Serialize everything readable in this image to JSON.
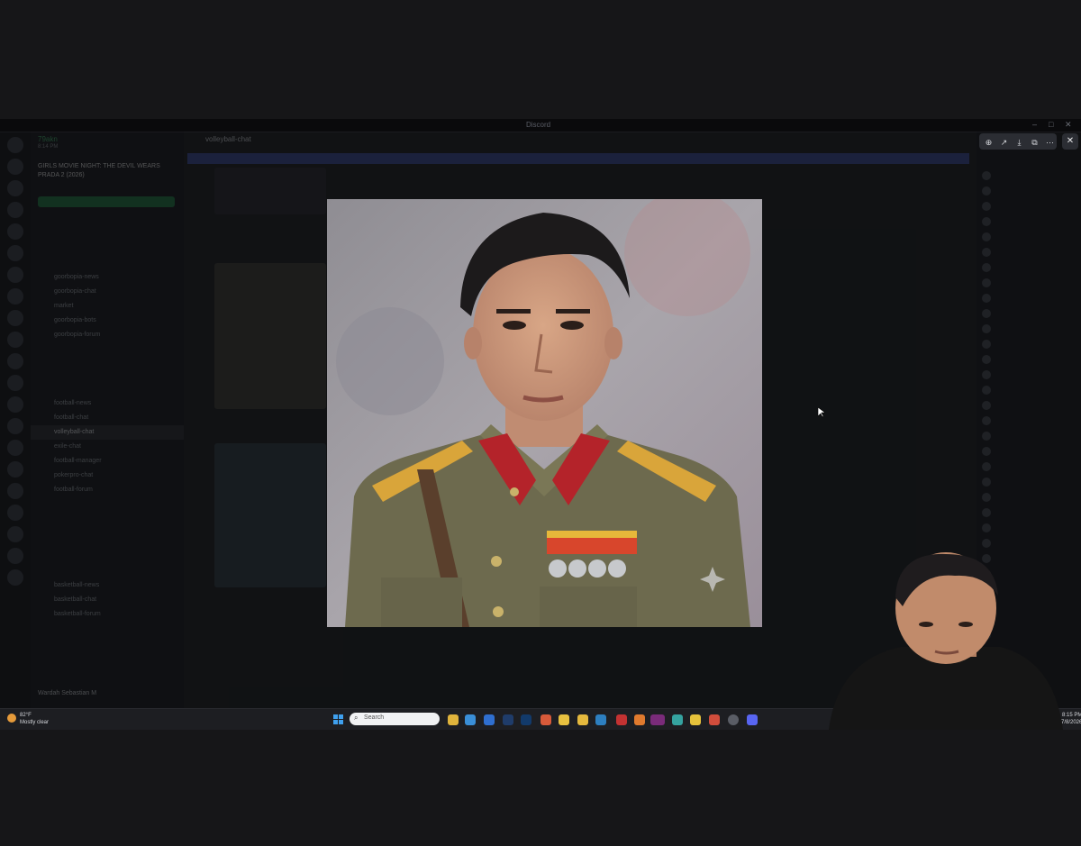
{
  "window": {
    "title": "Discord"
  },
  "discord": {
    "user": {
      "name": "79akn",
      "status": "8:14 PM"
    },
    "event": {
      "title": "GIRLS MOVIE NIGHT: THE DEVIL WEARS PRADA 2 (2026)"
    },
    "channels": [
      "goorbopia-news",
      "goorbopia-chat",
      "market",
      "goorbopia-bots",
      "goorbopia-forum",
      "football-news",
      "football-chat",
      "volleyball-chat",
      "exile-chat",
      "football-manager",
      "pokerpro-chat",
      "football-forum",
      "basketball-news",
      "basketball-chat",
      "basketball-forum"
    ],
    "selected_channel": "volleyball-chat",
    "channel_header": "volleyball-chat",
    "current_user": "Wardah Sebastian M"
  },
  "viewer": {
    "tools": [
      "zoom-in",
      "forward",
      "download",
      "open-external",
      "more"
    ],
    "close_label": "✕"
  },
  "taskbar": {
    "weather_temp": "82°F",
    "weather_desc": "Mostly clear",
    "search_placeholder": "Search",
    "time": "8:15 PM",
    "date": "7/8/2026"
  }
}
